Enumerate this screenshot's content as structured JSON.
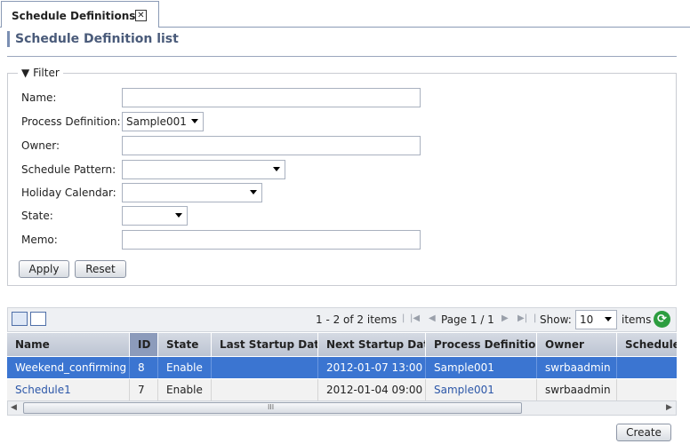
{
  "tab": {
    "label": "Schedule Definitions",
    "close": "✕"
  },
  "header": {
    "title": "Schedule Definition list"
  },
  "filter": {
    "legend": "Filter",
    "fields": {
      "name": {
        "label": "Name:",
        "value": ""
      },
      "process_definition": {
        "label": "Process Definition:",
        "value": "Sample001"
      },
      "owner": {
        "label": "Owner:",
        "value": ""
      },
      "schedule_pattern": {
        "label": "Schedule Pattern:",
        "value": ""
      },
      "holiday_calendar": {
        "label": "Holiday Calendar:",
        "value": ""
      },
      "state": {
        "label": "State:",
        "value": ""
      },
      "memo": {
        "label": "Memo:",
        "value": ""
      }
    },
    "apply_label": "Apply",
    "reset_label": "Reset"
  },
  "pager": {
    "range_text": "1 - 2 of 2 items",
    "page_text": "Page 1 / 1",
    "show_label": "Show:",
    "show_value": "10",
    "items_label": "items"
  },
  "table": {
    "columns": [
      "Name",
      "ID",
      "State",
      "Last Startup Date",
      "Next Startup Date",
      "Process Definition",
      "Owner",
      "Schedule Pattern"
    ],
    "rows": [
      {
        "name": "Weekend_confirming",
        "id": "8",
        "state": "Enable",
        "last_startup": "",
        "next_startup": "2012-01-07 13:00",
        "process_definition": "Sample001",
        "owner": "swrbaadmin",
        "schedule": ""
      },
      {
        "name": "Schedule1",
        "id": "7",
        "state": "Enable",
        "last_startup": "",
        "next_startup": "2012-01-04 09:00",
        "process_definition": "Sample001",
        "owner": "swrbaadmin",
        "schedule": ""
      }
    ],
    "selected_row": 0,
    "sorted_column": "ID"
  },
  "scrollbar": {
    "grip": "III"
  },
  "footer": {
    "create_label": "Create"
  },
  "colors": {
    "accent": "#3b75d1",
    "link": "#2c57a8",
    "header_bar": "#7b8fb3"
  }
}
